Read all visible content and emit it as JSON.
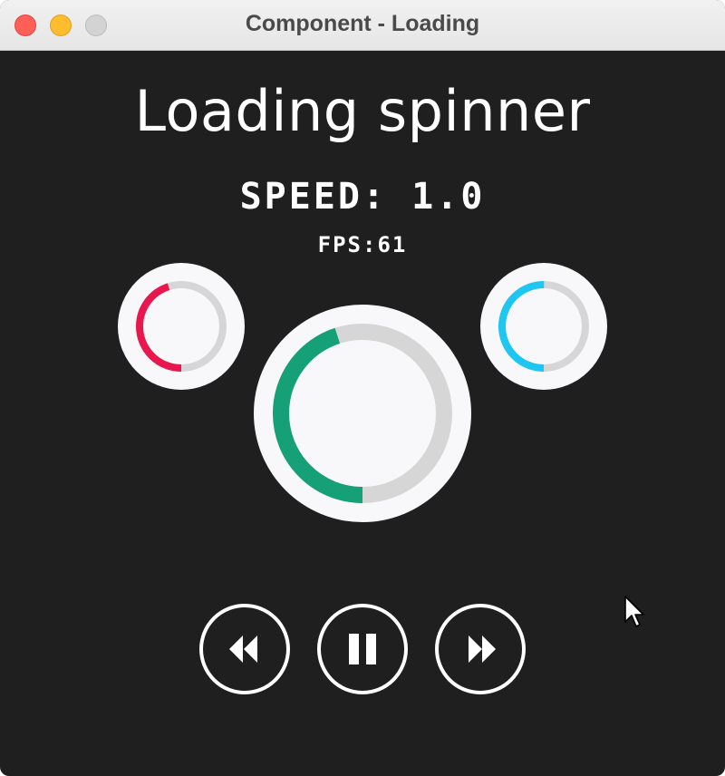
{
  "window": {
    "title": "Component - Loading"
  },
  "heading": "Loading spinner",
  "speed_label": "SPEED: 1.0",
  "fps_label": "FPS:61",
  "colors": {
    "background": "#1f1f1f",
    "track": "#d6d6d6",
    "spinner_left": "#e8184f",
    "spinner_center": "#15a077",
    "spinner_right": "#1ec6f2",
    "disc": "#f8f8fb"
  },
  "spinners": [
    {
      "name": "left",
      "progress": 0.45
    },
    {
      "name": "center",
      "progress": 0.45
    },
    {
      "name": "right",
      "progress": 0.5
    }
  ],
  "controls": {
    "rewind_icon": "rewind-icon",
    "pause_icon": "pause-icon",
    "forward_icon": "fast-forward-icon"
  }
}
